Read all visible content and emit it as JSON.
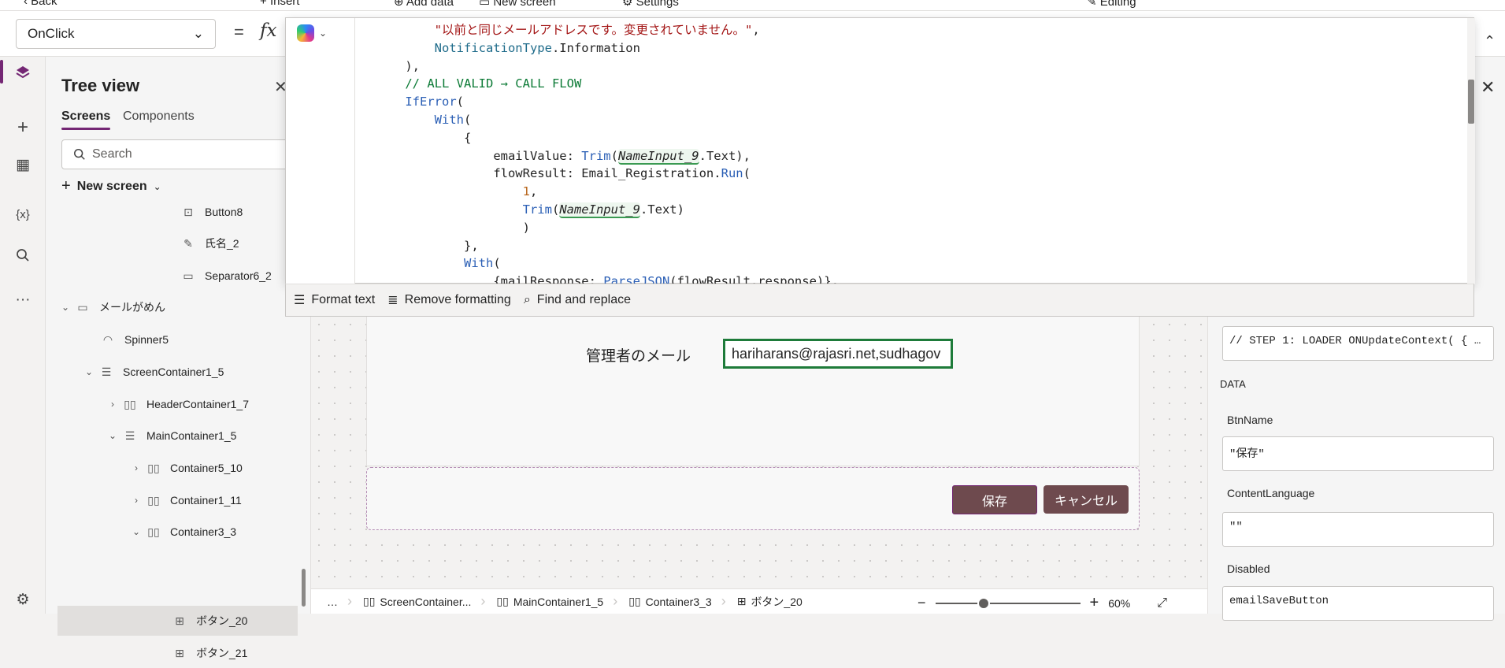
{
  "topbar": {
    "back": "Back",
    "insert": "Insert",
    "add_data": "Add data",
    "new_screen": "New screen",
    "settings": "Settings",
    "editing": "Editing"
  },
  "formula_bar": {
    "property": "OnClick",
    "equals": "=",
    "fx": "fx"
  },
  "rail": {
    "icons": [
      "layers-icon",
      "plus-icon",
      "table-icon",
      "variables-icon",
      "search-icon",
      "more-icon",
      "settings-icon"
    ],
    "variables_glyph": "{x}"
  },
  "tree": {
    "title": "Tree view",
    "tabs": [
      "Screens",
      "Components"
    ],
    "search_placeholder": "Search",
    "new_screen": "New screen",
    "nodes": [
      {
        "label": "Button8"
      },
      {
        "label": "氏名_2"
      },
      {
        "label": "Separator6_2"
      },
      {
        "label": "メールがめん"
      },
      {
        "label": "Spinner5"
      },
      {
        "label": "ScreenContainer1_5"
      },
      {
        "label": "HeaderContainer1_7"
      },
      {
        "label": "MainContainer1_5"
      },
      {
        "label": "Container5_10"
      },
      {
        "label": "Container1_11"
      },
      {
        "label": "Container3_3"
      },
      {
        "label": "ボタン_20"
      },
      {
        "label": "ボタン_21"
      }
    ]
  },
  "editor": {
    "lines": [
      [
        {
          "c": "str",
          "t": "\"以前と同じメールアドレスです。変更されていません。\""
        },
        {
          "c": "pl",
          "t": ","
        }
      ],
      [
        {
          "c": "id",
          "t": "NotificationType"
        },
        {
          "c": "pl",
          "t": ".Information"
        }
      ],
      [
        {
          "c": "pl",
          "t": "),"
        }
      ],
      [
        {
          "c": "cm",
          "t": "// ALL VALID → CALL FLOW"
        }
      ],
      [
        {
          "c": "kw",
          "t": "IfError"
        },
        {
          "c": "pl",
          "t": "("
        }
      ],
      [
        {
          "c": "kw",
          "t": "With"
        },
        {
          "c": "pl",
          "t": "("
        }
      ],
      [
        {
          "c": "pl",
          "t": "{"
        }
      ],
      [
        {
          "c": "pl",
          "t": "emailValue: "
        },
        {
          "c": "kw",
          "t": "Trim"
        },
        {
          "c": "pl",
          "t": "("
        },
        {
          "c": "ctl",
          "t": "NameInput_9"
        },
        {
          "c": "pl",
          "t": ".Text),"
        }
      ],
      [
        {
          "c": "pl",
          "t": "flowResult: Email_Registration."
        },
        {
          "c": "kw",
          "t": "Run"
        },
        {
          "c": "pl",
          "t": "("
        }
      ],
      [
        {
          "c": "num",
          "t": "1"
        },
        {
          "c": "pl",
          "t": ","
        }
      ],
      [
        {
          "c": "kw",
          "t": "Trim"
        },
        {
          "c": "pl",
          "t": "("
        },
        {
          "c": "ctl",
          "t": "NameInput_9"
        },
        {
          "c": "pl",
          "t": ".Text)"
        }
      ],
      [
        {
          "c": "pl",
          "t": ")"
        }
      ],
      [
        {
          "c": "pl",
          "t": "},"
        }
      ],
      [
        {
          "c": "kw",
          "t": "With"
        },
        {
          "c": "pl",
          "t": "("
        }
      ],
      [
        {
          "c": "pl",
          "t": "{mailResponse: "
        },
        {
          "c": "kw",
          "t": "ParseJSON"
        },
        {
          "c": "pl",
          "t": "(flowResult.response)},"
        }
      ]
    ],
    "toolbar": {
      "format": "Format text",
      "remove": "Remove formatting",
      "find": "Find and replace"
    }
  },
  "canvas": {
    "mail_label": "管理者のメール",
    "mail_value": "hariharans@rajasri.net,sudhagov",
    "save": "保存",
    "cancel": "キャンセル"
  },
  "breadcrumb": {
    "more": "…",
    "items": [
      "ScreenContainer...",
      "MainContainer1_5",
      "Container3_3",
      "ボタン_20"
    ]
  },
  "zoom": {
    "minus": "−",
    "plus": "+",
    "value": "60%",
    "level_percent": 60
  },
  "props": {
    "onselect_value": "// STEP 1: LOADER ONUpdateContext( { …",
    "section": "DATA",
    "fields": [
      {
        "label": "BtnName",
        "value": "\"保存\""
      },
      {
        "label": "ContentLanguage",
        "value": "\"\""
      },
      {
        "label": "Disabled",
        "value": "emailSaveButton"
      }
    ]
  }
}
